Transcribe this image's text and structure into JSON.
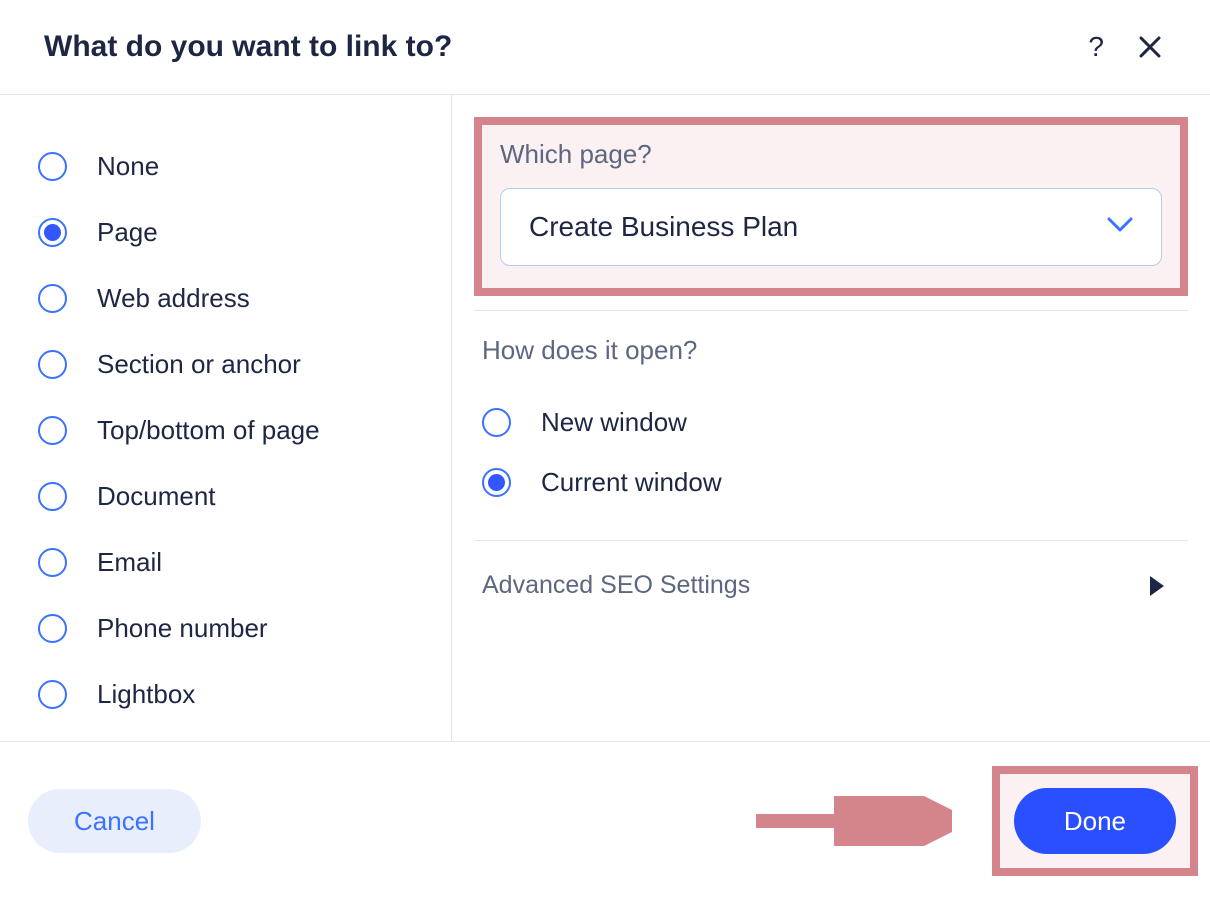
{
  "dialog": {
    "title": "What do you want to link to?",
    "help_icon": "?",
    "link_types": [
      {
        "key": "none",
        "label": "None",
        "selected": false
      },
      {
        "key": "page",
        "label": "Page",
        "selected": true
      },
      {
        "key": "web",
        "label": "Web address",
        "selected": false
      },
      {
        "key": "section",
        "label": "Section or anchor",
        "selected": false
      },
      {
        "key": "topbot",
        "label": "Top/bottom of page",
        "selected": false
      },
      {
        "key": "doc",
        "label": "Document",
        "selected": false
      },
      {
        "key": "email",
        "label": "Email",
        "selected": false
      },
      {
        "key": "phone",
        "label": "Phone number",
        "selected": false
      },
      {
        "key": "lightbox",
        "label": "Lightbox",
        "selected": false
      }
    ],
    "page_section": {
      "label": "Which page?",
      "selected_page": "Create Business Plan"
    },
    "open_section": {
      "label": "How does it open?",
      "options": [
        {
          "key": "new",
          "label": "New window",
          "selected": false
        },
        {
          "key": "current",
          "label": "Current window",
          "selected": true
        }
      ]
    },
    "seo_section": {
      "label": "Advanced SEO Settings"
    },
    "footer": {
      "cancel_label": "Cancel",
      "done_label": "Done"
    }
  },
  "annotation": {
    "color": "#d4858b"
  }
}
